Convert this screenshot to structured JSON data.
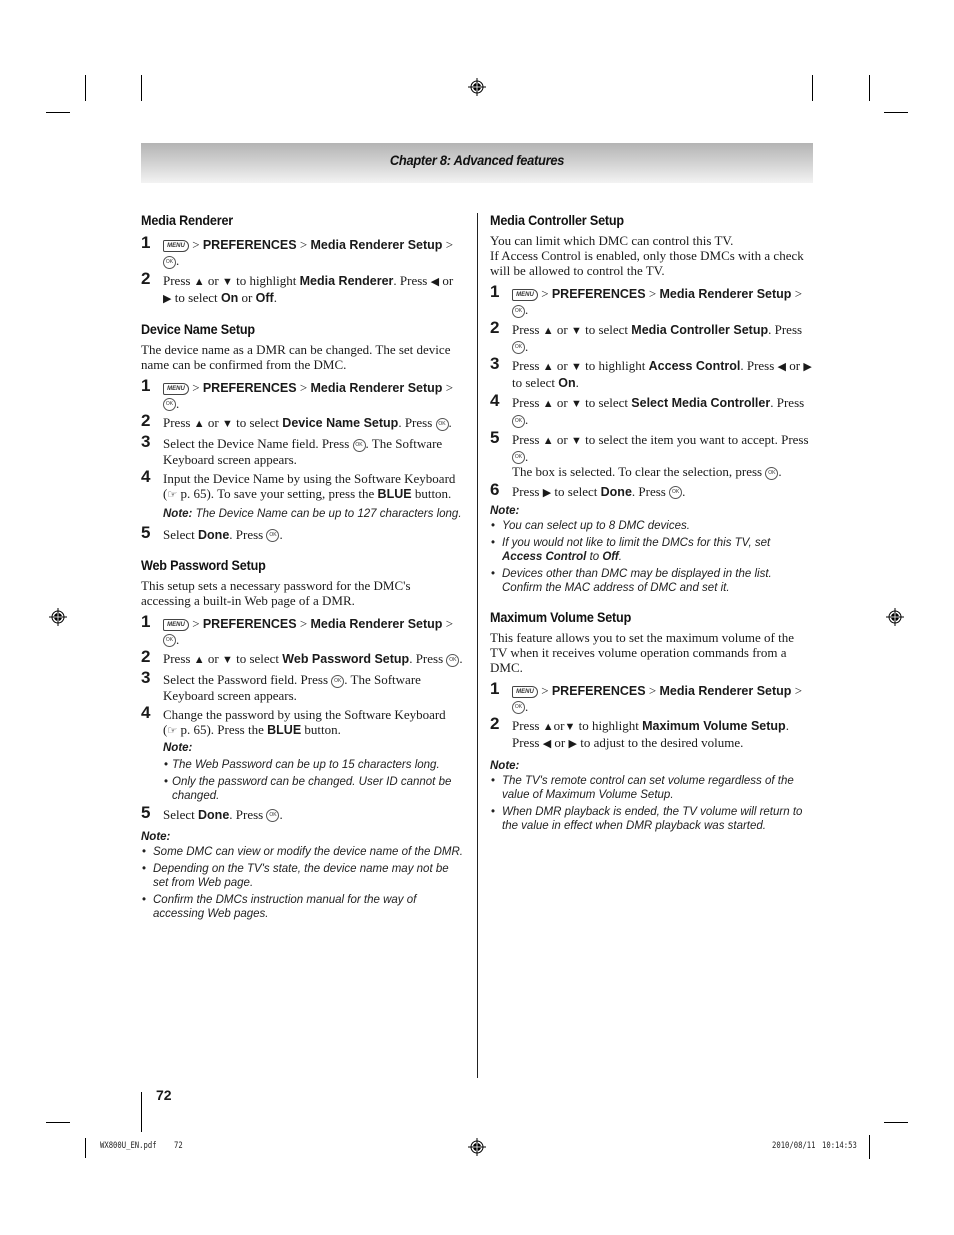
{
  "header": {
    "chapter_title": "Chapter 8: Advanced features"
  },
  "icons": {
    "menu": "MENU",
    "ok": "OK",
    "up": "▲",
    "down": "▼",
    "left": "◀",
    "right": "▶",
    "ref": "☞"
  },
  "left": {
    "media_renderer": {
      "title": "Media Renderer",
      "steps": [
        {
          "num": "1",
          "path_a": "PREFERENCES",
          "path_b": "Media Renderer Setup"
        },
        {
          "num": "2",
          "t1": "Press",
          "t2": "or",
          "t3": "to highlight",
          "bold1": "Media Renderer",
          "t4": ". Press",
          "t5": "or",
          "t6": "to select",
          "bold2": "On",
          "t7": "or",
          "bold3": "Off",
          "t8": "."
        }
      ]
    },
    "device_name": {
      "title": "Device Name Setup",
      "intro": "The device name as a DMR can be changed. The set device name can be confirmed from the DMC.",
      "steps": [
        {
          "num": "1",
          "path_a": "PREFERENCES",
          "path_b": "Media Renderer Setup"
        },
        {
          "num": "2",
          "t1": "Press",
          "t2": "or",
          "t3": "to select",
          "bold1": "Device Name Setup",
          "t4": ". Press"
        },
        {
          "num": "3",
          "t1": "Select the Device Name field. Press",
          "t2": ". The Software Keyboard screen appears."
        },
        {
          "num": "4",
          "t1": "Input the Device Name by using the Software Keyboard (",
          "t2": " p. 65). To save your setting, press the",
          "bold1": "BLUE",
          "t3": " button."
        },
        {
          "num": "5",
          "t1": "Select",
          "bold1": "Done",
          "t2": ". Press"
        }
      ],
      "inline_note_label": "Note:",
      "inline_note": "The Device Name can be up to 127 characters long."
    },
    "web_password": {
      "title": "Web Password Setup",
      "intro": "This setup sets a necessary password for the DMC's accessing a built-in Web page of a DMR.",
      "steps": [
        {
          "num": "1",
          "path_a": "PREFERENCES",
          "path_b": "Media Renderer Setup"
        },
        {
          "num": "2",
          "t1": "Press",
          "t2": "or",
          "t3": "to select",
          "bold1": "Web Password Setup",
          "t4": ". Press"
        },
        {
          "num": "3",
          "t1": "Select the Password field. Press",
          "t2": ". The Software Keyboard screen appears."
        },
        {
          "num": "4",
          "t1": "Change the password by using the Software Keyboard (",
          "t2": " p. 65). Press the",
          "bold1": "BLUE",
          "t3": " button."
        },
        {
          "num": "5",
          "t1": "Select",
          "bold1": "Done",
          "t2": ". Press"
        }
      ],
      "inner_note_label": "Note:",
      "inner_notes": [
        "The Web Password can be up to 15 characters long.",
        "Only the password can be changed. User ID cannot be changed."
      ]
    },
    "note_label": "Note:",
    "notes": [
      "Some DMC can view or modify the device name of the DMR.",
      "Depending on the TV's state, the device name may not be set from Web page.",
      "Confirm the DMCs instruction manual for the way of accessing Web pages."
    ]
  },
  "right": {
    "media_controller": {
      "title": "Media Controller Setup",
      "intro1": "You can limit which DMC can control this TV.",
      "intro2": "If Access Control is enabled, only those DMCs with a check will be allowed to control the TV.",
      "steps": [
        {
          "num": "1",
          "path_a": "PREFERENCES",
          "path_b": "Media Renderer Setup"
        },
        {
          "num": "2",
          "t1": "Press",
          "t2": "or",
          "t3": "to select",
          "bold1": "Media Controller Setup",
          "t4": ". Press"
        },
        {
          "num": "3",
          "t1": "Press",
          "t2": "or",
          "t3": "to highlight",
          "bold1": "Access Control",
          "t4": ". Press",
          "t5": "or",
          "t6": "to select",
          "bold2": "On",
          "t7": "."
        },
        {
          "num": "4",
          "t1": "Press",
          "t2": "or",
          "t3": "to select",
          "bold1": "Select Media Controller",
          "t4": ". Press"
        },
        {
          "num": "5",
          "t1": "Press",
          "t2": "or",
          "t3": "to select the item you want to accept. Press",
          "t4": "The box is selected. To clear the selection, press"
        },
        {
          "num": "6",
          "t1": "Press",
          "t2": "to select",
          "bold1": "Done",
          "t3": ". Press"
        }
      ],
      "note_label": "Note:",
      "notes": [
        {
          "text": "You can select up to 8 DMC devices."
        },
        {
          "pre": "If you would not like to limit the DMCs for this TV, set",
          "bold1": "Access Control",
          "mid": "to",
          "bold2": "Off",
          "post": "."
        },
        {
          "text": "Devices other than DMC may be displayed in the list. Confirm the MAC address of DMC and set it."
        }
      ]
    },
    "max_volume": {
      "title": "Maximum Volume Setup",
      "intro": "This feature allows you to set the maximum volume of the TV when it receives volume operation commands from a DMC.",
      "steps": [
        {
          "num": "1",
          "path_a": "PREFERENCES",
          "path_b": "Media Renderer Setup"
        },
        {
          "num": "2",
          "t1": "Press",
          "t2": "or",
          "t3": "to highlight",
          "bold1": "Maximum Volume Setup",
          "t4": ". Press",
          "t5": "or",
          "t6": "to adjust to the desired volume."
        }
      ],
      "note_label": "Note:",
      "notes": [
        "The TV's remote control can set volume regardless of the value of Maximum Volume Setup.",
        "When DMR playback is ended, the TV volume will return to the value in effect when DMR playback was started."
      ]
    }
  },
  "footer": {
    "page_number": "72",
    "file_name": "WX800U_EN.pdf",
    "file_page": "72",
    "date": "2010/08/11",
    "time": "10:14:53"
  }
}
